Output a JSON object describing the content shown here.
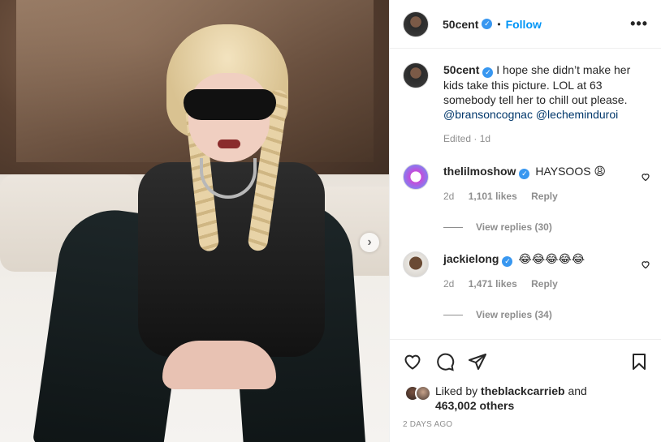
{
  "post": {
    "username": "50cent",
    "follow_label": "Follow",
    "separator": "•",
    "more_label": "•••"
  },
  "caption": {
    "username": "50cent",
    "text": "I hope she didn’t make her kids take this picture. LOL at 63 somebody tell her to chill out please.",
    "mentions": [
      "@bransoncognac",
      "@lecheminduroi"
    ],
    "meta": "Edited · 1d"
  },
  "comments": [
    {
      "username": "thelilmoshow",
      "text": "HAYSOOS 😩",
      "age": "2d",
      "likes": "1,101 likes",
      "reply_label": "Reply",
      "view_replies": "View replies (30)"
    },
    {
      "username": "jackielong",
      "text": "😂😂😂😂😂",
      "age": "2d",
      "likes": "1,471 likes",
      "reply_label": "Reply",
      "view_replies": "View replies (34)"
    }
  ],
  "likes": {
    "prefix": "Liked by",
    "user": "theblackcarrieb",
    "and": "and",
    "others": "463,002 others"
  },
  "timestamp": "2 DAYS AGO",
  "icons": {
    "verified": "verified-badge-icon",
    "next": "chevron-right-icon",
    "like": "heart-icon",
    "comment": "comment-icon",
    "share": "share-icon",
    "save": "bookmark-icon"
  },
  "colors": {
    "accent": "#0095f6",
    "verified": "#3897f0",
    "muted": "#8e8e8e",
    "text": "#262626"
  }
}
